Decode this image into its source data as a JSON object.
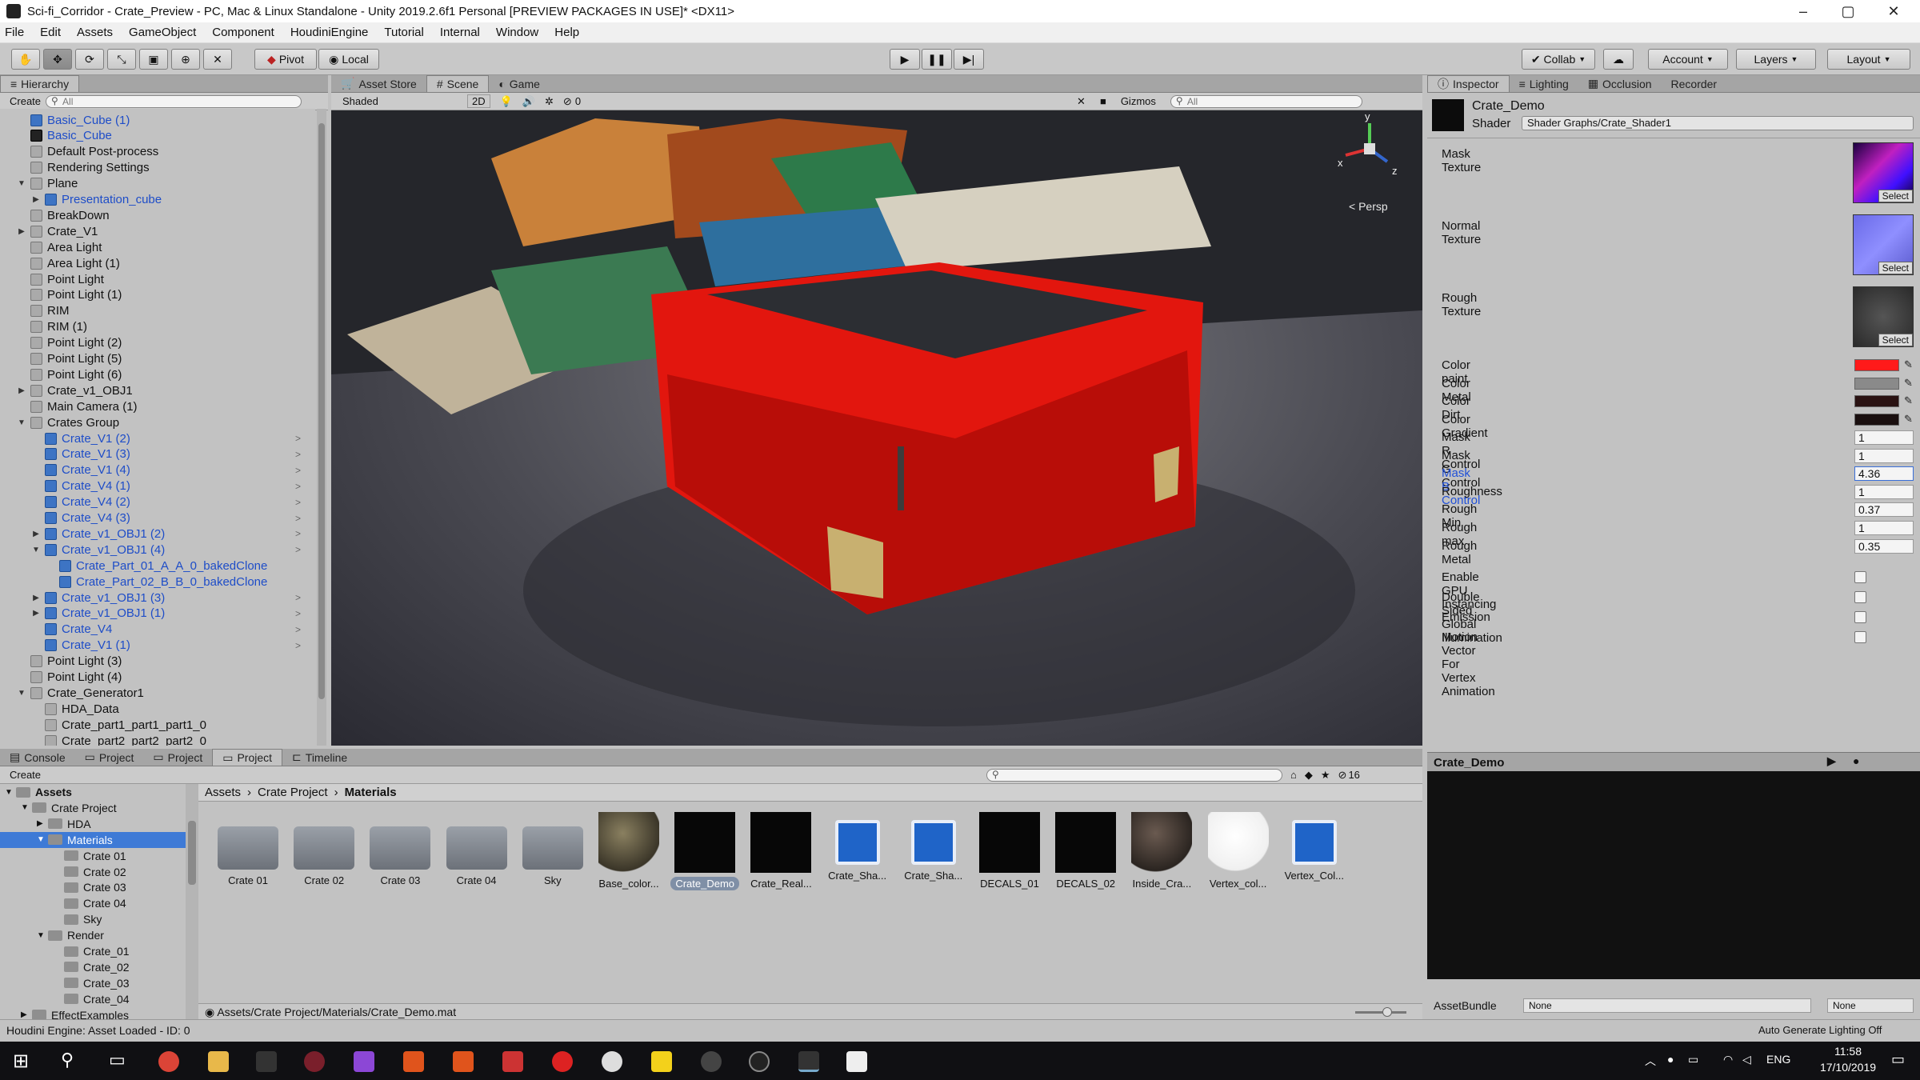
{
  "window": {
    "title": "Sci-fi_Corridor - Crate_Preview - PC, Mac & Linux Standalone - Unity 2019.2.6f1 Personal [PREVIEW PACKAGES IN USE]* <DX11>",
    "minimize": "–",
    "maximize": "▢",
    "close": "✕"
  },
  "menu": [
    "File",
    "Edit",
    "Assets",
    "GameObject",
    "Component",
    "HoudiniEngine",
    "Tutorial",
    "Internal",
    "Window",
    "Help"
  ],
  "toolbar": {
    "pivot": "Pivot",
    "local": "Local",
    "collab": "Collab",
    "account": "Account",
    "layers": "Layers",
    "layout": "Layout"
  },
  "hierarchy": {
    "tab": "Hierarchy",
    "create": "Create",
    "search": "All",
    "items": [
      {
        "label": "Basic_Cube (1)",
        "depth": 1,
        "icon": "blue",
        "arrow": "",
        "color": "blue"
      },
      {
        "label": "Basic_Cube",
        "depth": 1,
        "icon": "bk",
        "arrow": "",
        "color": "blue"
      },
      {
        "label": "Default Post-process",
        "depth": 1,
        "icon": "grey",
        "arrow": "",
        "color": ""
      },
      {
        "label": "Rendering Settings",
        "depth": 1,
        "icon": "grey",
        "arrow": "",
        "color": ""
      },
      {
        "label": "Plane",
        "depth": 1,
        "icon": "grey",
        "arrow": "down",
        "color": ""
      },
      {
        "label": "Presentation_cube",
        "depth": 2,
        "icon": "blue",
        "arrow": "right",
        "color": "blue"
      },
      {
        "label": "BreakDown",
        "depth": 1,
        "icon": "grey",
        "arrow": "",
        "color": ""
      },
      {
        "label": "Crate_V1",
        "depth": 1,
        "icon": "grey",
        "arrow": "right",
        "color": ""
      },
      {
        "label": "Area Light",
        "depth": 1,
        "icon": "grey",
        "arrow": "",
        "color": ""
      },
      {
        "label": "Area Light (1)",
        "depth": 1,
        "icon": "grey",
        "arrow": "",
        "color": ""
      },
      {
        "label": "Point Light",
        "depth": 1,
        "icon": "grey",
        "arrow": "",
        "color": ""
      },
      {
        "label": "Point Light (1)",
        "depth": 1,
        "icon": "grey",
        "arrow": "",
        "color": ""
      },
      {
        "label": "RIM",
        "depth": 1,
        "icon": "grey",
        "arrow": "",
        "color": ""
      },
      {
        "label": "RIM (1)",
        "depth": 1,
        "icon": "grey",
        "arrow": "",
        "color": ""
      },
      {
        "label": "Point Light (2)",
        "depth": 1,
        "icon": "grey",
        "arrow": "",
        "color": ""
      },
      {
        "label": "Point Light (5)",
        "depth": 1,
        "icon": "grey",
        "arrow": "",
        "color": ""
      },
      {
        "label": "Point Light (6)",
        "depth": 1,
        "icon": "grey",
        "arrow": "",
        "color": ""
      },
      {
        "label": "Crate_v1_OBJ1",
        "depth": 1,
        "icon": "grey",
        "arrow": "right",
        "color": ""
      },
      {
        "label": "Main Camera (1)",
        "depth": 1,
        "icon": "grey",
        "arrow": "",
        "color": ""
      },
      {
        "label": "Crates Group",
        "depth": 1,
        "icon": "grey",
        "arrow": "down",
        "color": ""
      },
      {
        "label": "Crate_V1 (2)",
        "depth": 2,
        "icon": "blue",
        "arrow": "",
        "color": "blue",
        "more": true
      },
      {
        "label": "Crate_V1 (3)",
        "depth": 2,
        "icon": "blue",
        "arrow": "",
        "color": "blue",
        "more": true
      },
      {
        "label": "Crate_V1 (4)",
        "depth": 2,
        "icon": "blue",
        "arrow": "",
        "color": "blue",
        "more": true
      },
      {
        "label": "Crate_V4 (1)",
        "depth": 2,
        "icon": "blue",
        "arrow": "",
        "color": "blue",
        "more": true
      },
      {
        "label": "Crate_V4 (2)",
        "depth": 2,
        "icon": "blue",
        "arrow": "",
        "color": "blue",
        "more": true
      },
      {
        "label": "Crate_V4 (3)",
        "depth": 2,
        "icon": "blue",
        "arrow": "",
        "color": "blue",
        "more": true
      },
      {
        "label": "Crate_v1_OBJ1 (2)",
        "depth": 2,
        "icon": "blue",
        "arrow": "right",
        "color": "blue",
        "more": true
      },
      {
        "label": "Crate_v1_OBJ1 (4)",
        "depth": 2,
        "icon": "blue",
        "arrow": "down",
        "color": "blue",
        "more": true
      },
      {
        "label": "Crate_Part_01_A_A_0_bakedClone",
        "depth": 3,
        "icon": "blue",
        "arrow": "",
        "color": "blue"
      },
      {
        "label": "Crate_Part_02_B_B_0_bakedClone",
        "depth": 3,
        "icon": "blue",
        "arrow": "",
        "color": "blue"
      },
      {
        "label": "Crate_v1_OBJ1 (3)",
        "depth": 2,
        "icon": "blue",
        "arrow": "right",
        "color": "blue",
        "more": true
      },
      {
        "label": "Crate_v1_OBJ1 (1)",
        "depth": 2,
        "icon": "blue",
        "arrow": "right",
        "color": "blue",
        "more": true
      },
      {
        "label": "Crate_V4",
        "depth": 2,
        "icon": "blue",
        "arrow": "",
        "color": "blue",
        "more": true
      },
      {
        "label": "Crate_V1 (1)",
        "depth": 2,
        "icon": "blue",
        "arrow": "",
        "color": "blue",
        "more": true
      },
      {
        "label": "Point Light (3)",
        "depth": 1,
        "icon": "grey",
        "arrow": "",
        "color": ""
      },
      {
        "label": "Point Light (4)",
        "depth": 1,
        "icon": "grey",
        "arrow": "",
        "color": ""
      },
      {
        "label": "Crate_Generator1",
        "depth": 1,
        "icon": "grey",
        "arrow": "down",
        "color": ""
      },
      {
        "label": "HDA_Data",
        "depth": 2,
        "icon": "grey",
        "arrow": "",
        "color": ""
      },
      {
        "label": "Crate_part1_part1_part1_0",
        "depth": 2,
        "icon": "grey",
        "arrow": "",
        "color": ""
      },
      {
        "label": "Crate_part2_part2_part2_0",
        "depth": 2,
        "icon": "grey",
        "arrow": "",
        "color": ""
      }
    ]
  },
  "scene": {
    "tabs": [
      "Asset Store",
      "Scene",
      "Game"
    ],
    "shading": "Shaded",
    "mode_2d": "2D",
    "gizmos": "Gizmos",
    "search": "All",
    "hidden_count": "0",
    "persp": "< Persp",
    "axis_y": "y",
    "axis_x": "x",
    "axis_z": "z"
  },
  "inspector": {
    "tabs": [
      "Inspector",
      "Lighting",
      "Occlusion",
      "Recorder"
    ],
    "material_name": "Crate_Demo",
    "shader_label": "Shader",
    "shader_value": "Shader Graphs/Crate_Shader1",
    "textures": [
      {
        "label": "Mask Texture",
        "select": "Select"
      },
      {
        "label": "Normal Texture",
        "select": "Select"
      },
      {
        "label": "Rough Texture",
        "select": "Select"
      }
    ],
    "colors": [
      {
        "label": "Color paint",
        "value": "#ff1a1a"
      },
      {
        "label": "Color Metal",
        "value": "#8a8a8a"
      },
      {
        "label": "Color Dirt",
        "value": "#2a1212"
      },
      {
        "label": "Color Gradient",
        "value": "#1a0f0f"
      }
    ],
    "fields": [
      {
        "label": "Mask R Control",
        "value": "1"
      },
      {
        "label": "Mask G Control",
        "value": "1"
      },
      {
        "label": "Mask B Control",
        "value": "4.36",
        "active": true
      },
      {
        "label": "Roughness",
        "value": "1"
      },
      {
        "label": "Rough Min",
        "value": "0.37"
      },
      {
        "label": "Rough max",
        "value": "1"
      },
      {
        "label": "Rough Metal",
        "value": "0.35"
      }
    ],
    "toggles": [
      "Enable GPU Instancing",
      "Double Sided Global Illumination",
      "Emission",
      "Motion Vector For Vertex Animation"
    ],
    "preview_title": "Crate_Demo",
    "assetbundle_label": "AssetBundle",
    "assetbundle_value": "None",
    "assetbundle_variant": "None"
  },
  "project": {
    "tabs": [
      "Console",
      "Project",
      "Project",
      "Project",
      "Timeline"
    ],
    "create": "Create",
    "breadcrumb": [
      "Assets",
      "Crate Project",
      "Materials"
    ],
    "count": "16",
    "tree": [
      {
        "label": "Assets",
        "depth": 0,
        "arrow": "down",
        "bold": true
      },
      {
        "label": "Crate Project",
        "depth": 1,
        "arrow": "down"
      },
      {
        "label": "HDA",
        "depth": 2,
        "arrow": "right"
      },
      {
        "label": "Materials",
        "depth": 2,
        "arrow": "down",
        "selected": true
      },
      {
        "label": "Crate 01",
        "depth": 3,
        "arrow": ""
      },
      {
        "label": "Crate 02",
        "depth": 3,
        "arrow": ""
      },
      {
        "label": "Crate 03",
        "depth": 3,
        "arrow": ""
      },
      {
        "label": "Crate 04",
        "depth": 3,
        "arrow": ""
      },
      {
        "label": "Sky",
        "depth": 3,
        "arrow": ""
      },
      {
        "label": "Render",
        "depth": 2,
        "arrow": "down"
      },
      {
        "label": "Crate_01",
        "depth": 3,
        "arrow": ""
      },
      {
        "label": "Crate_02",
        "depth": 3,
        "arrow": ""
      },
      {
        "label": "Crate_03",
        "depth": 3,
        "arrow": ""
      },
      {
        "label": "Crate_04",
        "depth": 3,
        "arrow": ""
      },
      {
        "label": "EffectExamples",
        "depth": 1,
        "arrow": "right"
      }
    ],
    "assets": [
      {
        "label": "Crate 01",
        "kind": "folder"
      },
      {
        "label": "Crate 02",
        "kind": "folder"
      },
      {
        "label": "Crate 03",
        "kind": "folder"
      },
      {
        "label": "Crate 04",
        "kind": "folder"
      },
      {
        "label": "Sky",
        "kind": "folder"
      },
      {
        "label": "Base_color...",
        "kind": "sphere-olive"
      },
      {
        "label": "Crate_Demo",
        "kind": "black",
        "selected": true
      },
      {
        "label": "Crate_Real...",
        "kind": "black"
      },
      {
        "label": "Crate_Sha...",
        "kind": "shader"
      },
      {
        "label": "Crate_Sha...",
        "kind": "shader"
      },
      {
        "label": "DECALS_01",
        "kind": "black"
      },
      {
        "label": "DECALS_02",
        "kind": "black"
      },
      {
        "label": "Inside_Cra...",
        "kind": "sphere-dark"
      },
      {
        "label": "Vertex_col...",
        "kind": "sphere-white"
      },
      {
        "label": "Vertex_Col...",
        "kind": "shader"
      }
    ],
    "path": "Assets/Crate Project/Materials/Crate_Demo.mat"
  },
  "status": {
    "left": "Houdini Engine: Asset Loaded - ID: 0",
    "right": "Auto Generate Lighting Off"
  },
  "taskbar": {
    "lang": "ENG",
    "time": "11:58",
    "date": "17/10/2019"
  }
}
